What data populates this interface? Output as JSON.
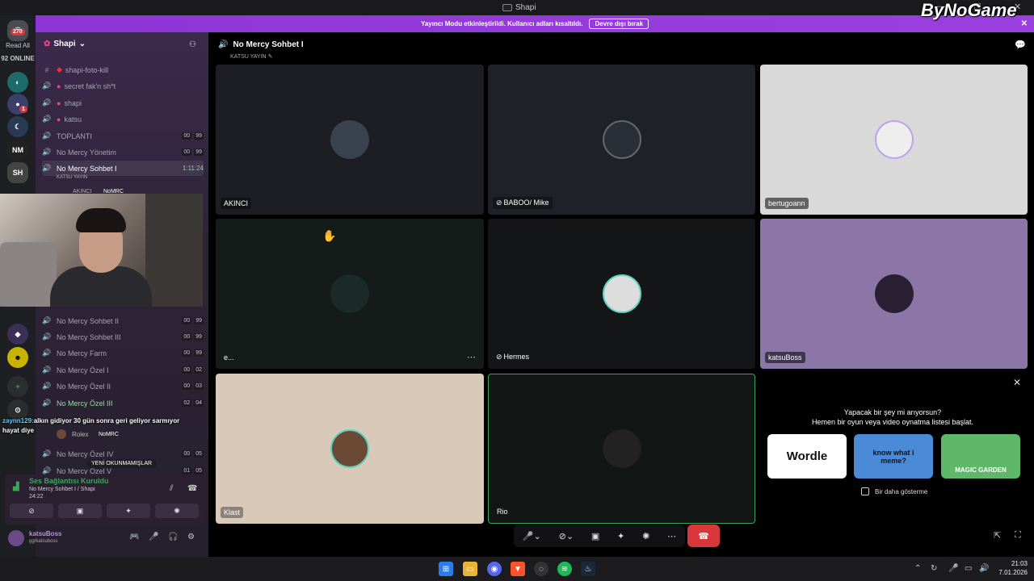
{
  "window": {
    "title": "Shapi"
  },
  "watermark": "ByNoGame",
  "banner": {
    "text": "Yayıncı Modu etkinleştirildi. Kullanıcı adları kısaltıldı.",
    "button": "Devre dışı bırak"
  },
  "rail": {
    "unread_badge": "270",
    "read_all": "Read All",
    "online": "92 ONLINE",
    "server_badge": "1"
  },
  "server": {
    "name": "Shapi"
  },
  "channels": [
    {
      "icon": "#",
      "label": "shapi-foto-kill",
      "kind": "text"
    },
    {
      "icon": "voice",
      "label": "secret fak'n sh*t",
      "kind": "voice"
    },
    {
      "icon": "voice",
      "label": "shapi",
      "kind": "voice"
    },
    {
      "icon": "voice",
      "label": "katsu",
      "kind": "voice"
    },
    {
      "icon": "voice",
      "label": "TOPLANTI",
      "a": "00",
      "b": "99"
    },
    {
      "icon": "voice",
      "label": "No Mercy Yönetim",
      "a": "00",
      "b": "99"
    }
  ],
  "active_channel": {
    "label": "No Mercy Sohbet I",
    "time": "1:11:24",
    "sub": "KATSU YAYIN",
    "member": "AKINCI",
    "member_tag": "NoMRC"
  },
  "channels2": [
    {
      "label": "No Mercy Sohbet II",
      "a": "00",
      "b": "99"
    },
    {
      "label": "No Mercy Sohbet III",
      "a": "00",
      "b": "99"
    },
    {
      "label": "No Mercy Farm",
      "a": "00",
      "b": "99"
    },
    {
      "label": "No Mercy Özel I",
      "a": "00",
      "b": "02"
    },
    {
      "label": "No Mercy Özel II",
      "a": "00",
      "b": "03"
    },
    {
      "label": "No Mercy Özel III",
      "a": "02",
      "b": "04"
    }
  ],
  "rolex": {
    "name": "Rolex",
    "tag": "NoMRC"
  },
  "channels3": [
    {
      "label": "No Mercy Özel IV",
      "a": "00",
      "b": "05"
    },
    {
      "label": "No Mercy Özel V",
      "a": "01",
      "b": "05"
    }
  ],
  "unread_pill": "YENİ OKUNMAMIŞLAR",
  "chat": {
    "user": "zaynn129:",
    "line1": "alkın gidiyor 30 gün sonra geri geliyor sarmıyor",
    "line2": "hayat diye"
  },
  "voice_panel": {
    "status": "Ses Bağlantısı Kuruldu",
    "location": "No Mercy Sohbet I / Shapi",
    "timer": "24:22"
  },
  "user": {
    "name": "katsuBoss",
    "tag": "gg/katsuboss"
  },
  "stage": {
    "title": "No Mercy Sohbet I",
    "subtitle": "KATSU YAYIN"
  },
  "tiles": [
    {
      "name": "AKINCI",
      "bg": "#1c1e24"
    },
    {
      "name": "BABOO/ Mike",
      "bg": "#1e2228"
    },
    {
      "name": "bertugoann",
      "bg": "#d9d9d9"
    },
    {
      "name": "e...",
      "bg": "#151b19"
    },
    {
      "name": "Hermes",
      "bg": "#141517"
    },
    {
      "name": "katsuBoss",
      "bg": "#8c76a8"
    },
    {
      "name": "Klast",
      "bg": "#d9c9b8"
    },
    {
      "name": "Rio",
      "bg": "#121615"
    }
  ],
  "activity_prompt": {
    "line1": "Yapacak bir şey mi arıyorsun?",
    "line2": "Hemen bir oyun veya video oynatma listesi başlat.",
    "games": [
      "Wordle",
      "know what i meme?",
      "MAGIC GARDEN"
    ],
    "checkbox": "Bir daha gösterme"
  },
  "clock": {
    "time": "21:03",
    "date": "7.01.2026"
  }
}
